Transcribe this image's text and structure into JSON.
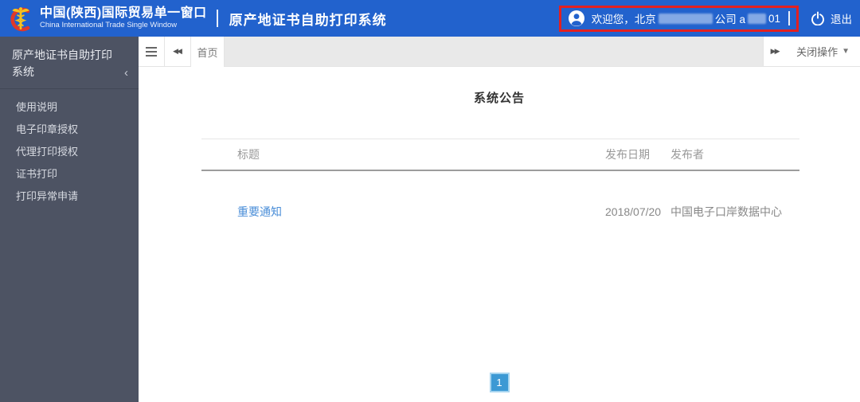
{
  "colors": {
    "header_blue": "#2262cd",
    "sidebar_bg": "#4d5363",
    "tab_strip_gray": "#e9e9e9",
    "link_blue": "#4a8ed8",
    "pagination_blue": "#3c99d4",
    "annotation_red": "#e32020"
  },
  "header": {
    "brand_title": "中国(陕西)国际贸易单一窗口",
    "brand_subtitle": "China International Trade Single Window",
    "divider": "|",
    "system_title": "原产地证书自助打印系统",
    "welcome": {
      "prefix": "欢迎您，北京",
      "middle": "公司 a",
      "suffix": "01"
    },
    "logout_label": "退出"
  },
  "sidebar": {
    "title": "原产地证书自助打印系统",
    "items": [
      {
        "label": "使用说明"
      },
      {
        "label": "电子印章授权"
      },
      {
        "label": "代理打印授权"
      },
      {
        "label": "证书打印"
      },
      {
        "label": "打印异常申请"
      }
    ]
  },
  "tabbar": {
    "active_tab": "首页",
    "close_menu_label": "关闭操作"
  },
  "icons": {
    "scroll_left": "◀◀",
    "scroll_right": "▶▶",
    "collapse_chevron": "‹",
    "caret_down": "▼"
  },
  "main": {
    "title": "系统公告",
    "table": {
      "columns": {
        "title": "标题",
        "date": "发布日期",
        "publisher": "发布者"
      },
      "rows": [
        {
          "title": "重要通知",
          "date": "2018/07/20",
          "publisher": "中国电子口岸数据中心"
        }
      ]
    },
    "pagination": {
      "current_page": "1"
    }
  }
}
